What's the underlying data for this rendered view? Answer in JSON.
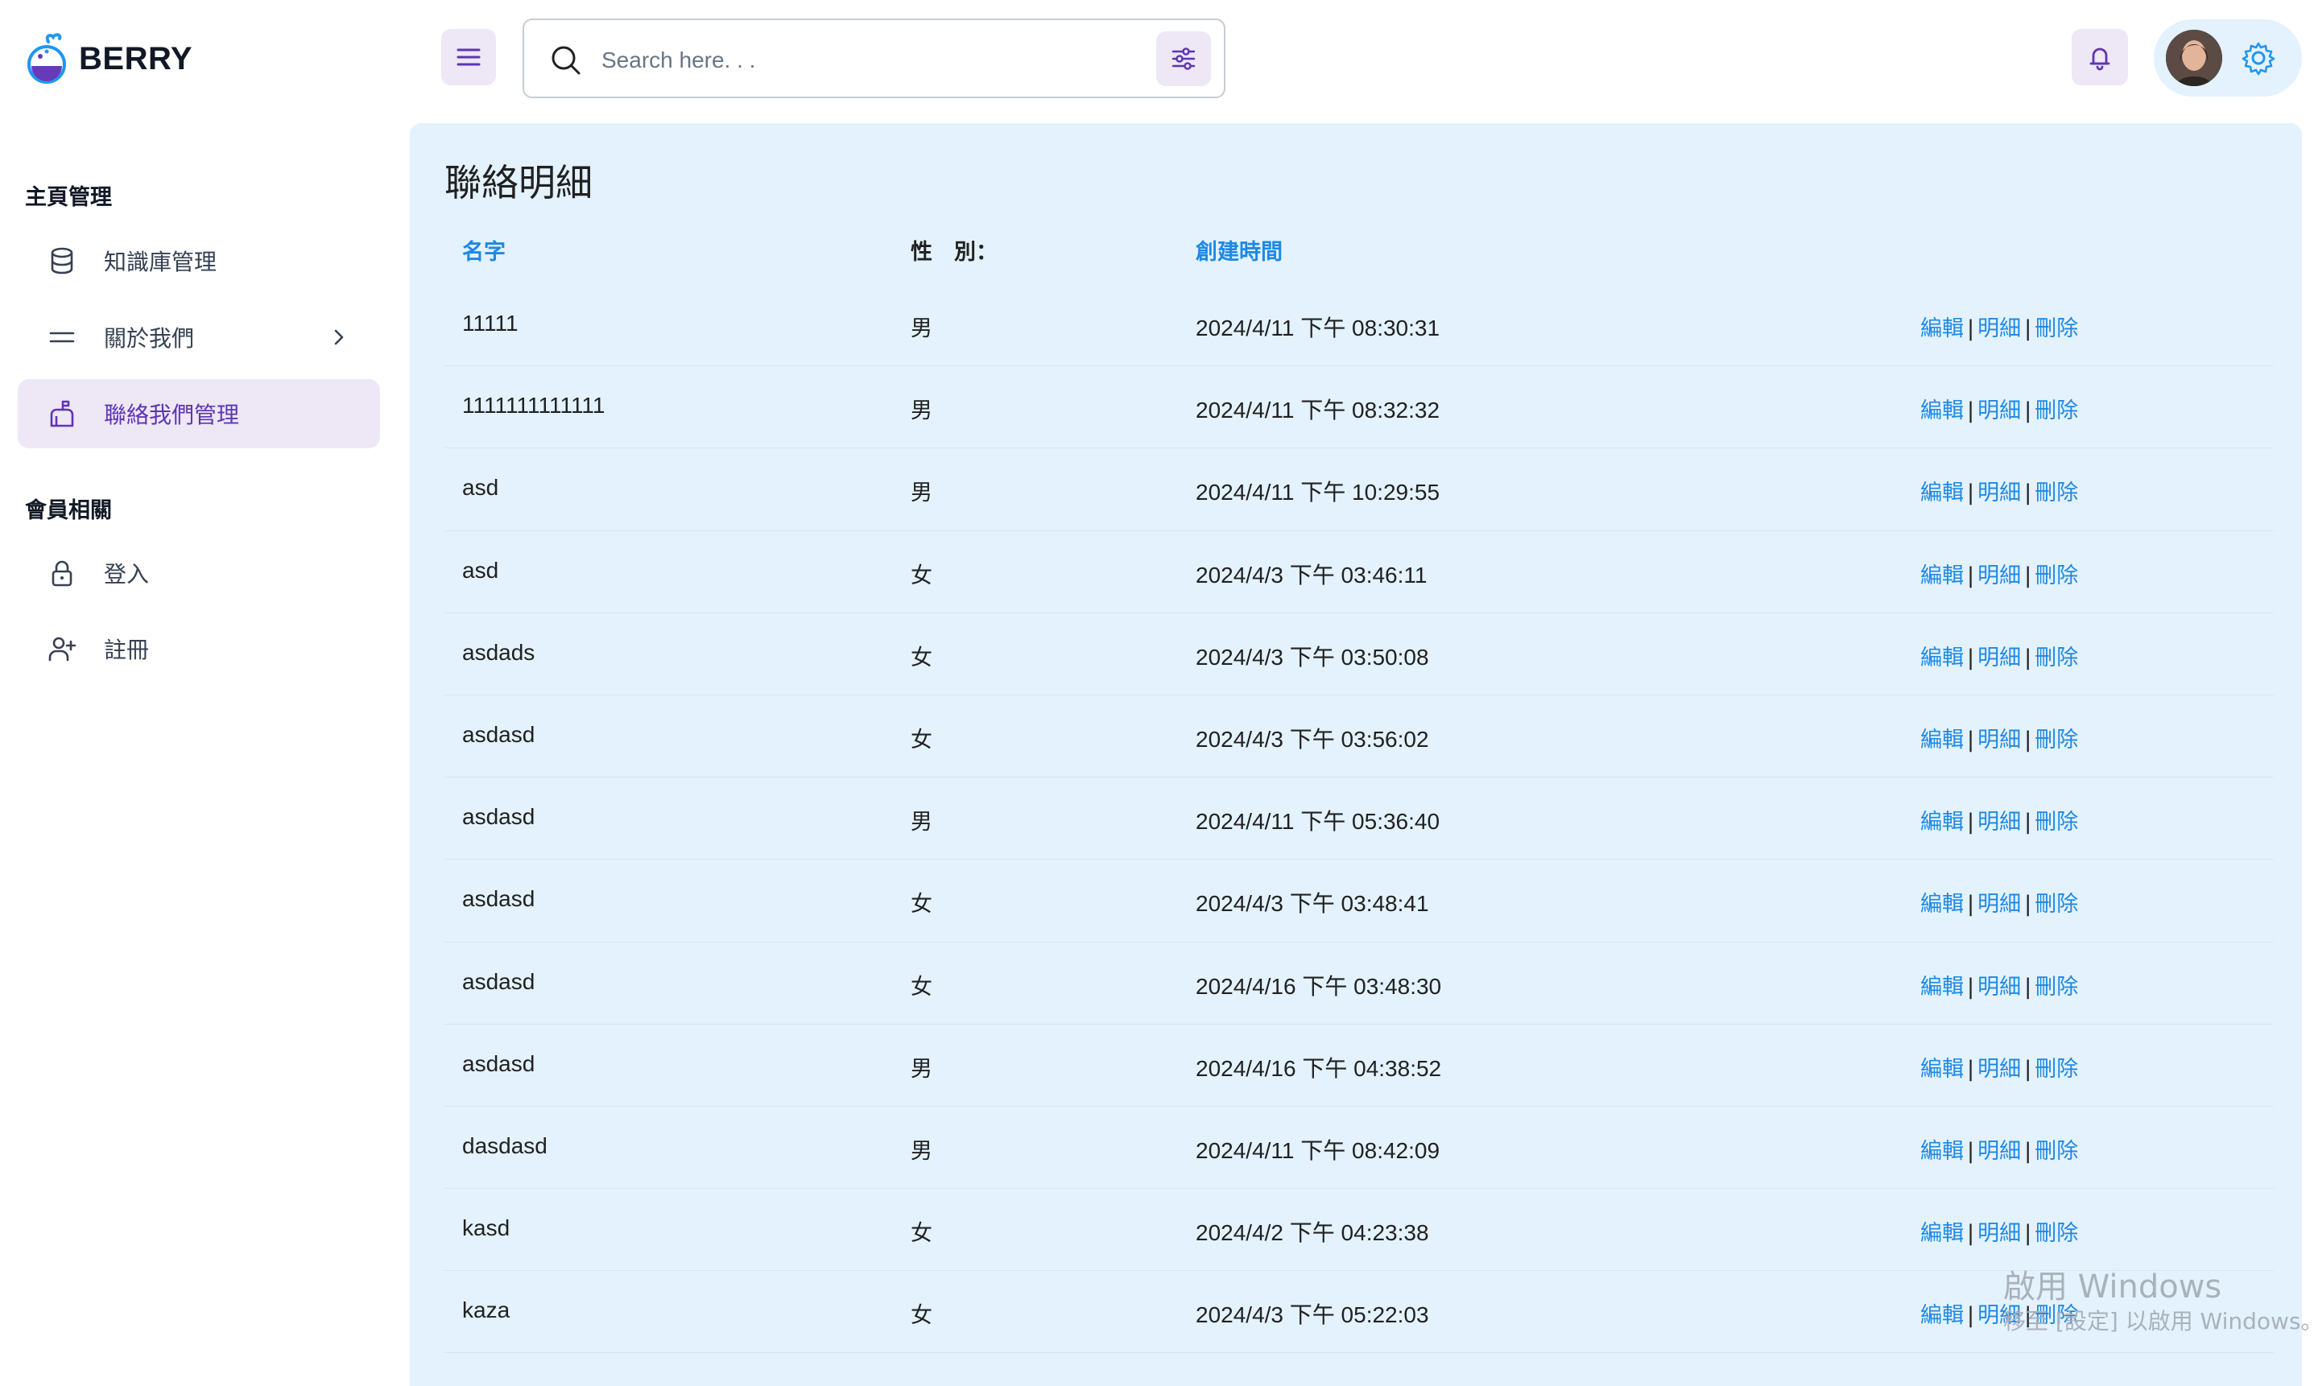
{
  "brand": {
    "name": "BERRY"
  },
  "header": {
    "search_placeholder": "Search here. . ."
  },
  "sidebar": {
    "sections": [
      {
        "title": "主頁管理"
      },
      {
        "title": "會員相關"
      }
    ],
    "items": [
      {
        "label": "知識庫管理",
        "icon": "database-icon"
      },
      {
        "label": "關於我們",
        "icon": "equals-icon"
      },
      {
        "label": "聯絡我們管理",
        "icon": "mailbox-icon"
      },
      {
        "label": "登入",
        "icon": "lock-icon"
      },
      {
        "label": "註冊",
        "icon": "user-plus-icon"
      }
    ]
  },
  "main": {
    "title": "聯絡明細",
    "columns": {
      "name": "名字",
      "gender": "性　別：",
      "created": "創建時間"
    },
    "action_labels": {
      "edit": "編輯",
      "detail": "明細",
      "delete": "刪除",
      "separator": "|"
    },
    "rows": [
      {
        "name": "11111",
        "gender": "男",
        "created": "2024/4/11 下午 08:30:31"
      },
      {
        "name": "1111111111111",
        "gender": "男",
        "created": "2024/4/11 下午 08:32:32"
      },
      {
        "name": "asd",
        "gender": "男",
        "created": "2024/4/11 下午 10:29:55"
      },
      {
        "name": "asd",
        "gender": "女",
        "created": "2024/4/3 下午 03:46:11"
      },
      {
        "name": "asdads",
        "gender": "女",
        "created": "2024/4/3 下午 03:50:08"
      },
      {
        "name": "asdasd",
        "gender": "女",
        "created": "2024/4/3 下午 03:56:02"
      },
      {
        "name": "asdasd",
        "gender": "男",
        "created": "2024/4/11 下午 05:36:40"
      },
      {
        "name": "asdasd",
        "gender": "女",
        "created": "2024/4/3 下午 03:48:41"
      },
      {
        "name": "asdasd",
        "gender": "女",
        "created": "2024/4/16 下午 03:48:30"
      },
      {
        "name": "asdasd",
        "gender": "男",
        "created": "2024/4/16 下午 04:38:52"
      },
      {
        "name": "dasdasd",
        "gender": "男",
        "created": "2024/4/11 下午 08:42:09"
      },
      {
        "name": "kasd",
        "gender": "女",
        "created": "2024/4/2 下午 04:23:38"
      },
      {
        "name": "kaza",
        "gender": "女",
        "created": "2024/4/3 下午 05:22:03"
      }
    ]
  },
  "watermark": {
    "title": "啟用 Windows",
    "subtitle": "移至 [設定] 以啟用 Windows。"
  },
  "colors": {
    "accent_purple": "#5e35b1",
    "accent_purple_light": "#ede7f6",
    "link_blue": "#1e88e5",
    "content_bg": "#e3f2fd"
  }
}
